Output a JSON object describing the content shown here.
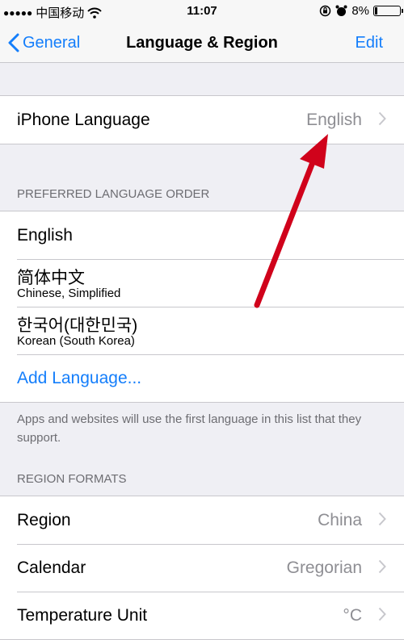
{
  "status_bar": {
    "signal_dots": "●●●●●",
    "carrier": "中国移动",
    "time": "11:07",
    "battery_percent": "8%",
    "battery_level": 0.08
  },
  "nav": {
    "back_label": "General",
    "title": "Language & Region",
    "edit_label": "Edit"
  },
  "iphone_language": {
    "label": "iPhone Language",
    "value": "English"
  },
  "preferred": {
    "header": "PREFERRED LANGUAGE ORDER",
    "items": [
      {
        "main": "English"
      },
      {
        "main": "简体中文",
        "sub": "Chinese, Simplified"
      },
      {
        "main": "한국어(대한민국)",
        "sub": "Korean (South Korea)"
      }
    ],
    "add_label": "Add Language...",
    "footer": "Apps and websites will use the first language in this list that they support."
  },
  "region_formats": {
    "header": "REGION FORMATS",
    "rows": [
      {
        "label": "Region",
        "value": "China"
      },
      {
        "label": "Calendar",
        "value": "Gregorian"
      },
      {
        "label": "Temperature Unit",
        "value": "°C"
      }
    ]
  },
  "colors": {
    "accent": "#147efb",
    "annotation_arrow": "#d0021b",
    "background": "#efeff4"
  }
}
